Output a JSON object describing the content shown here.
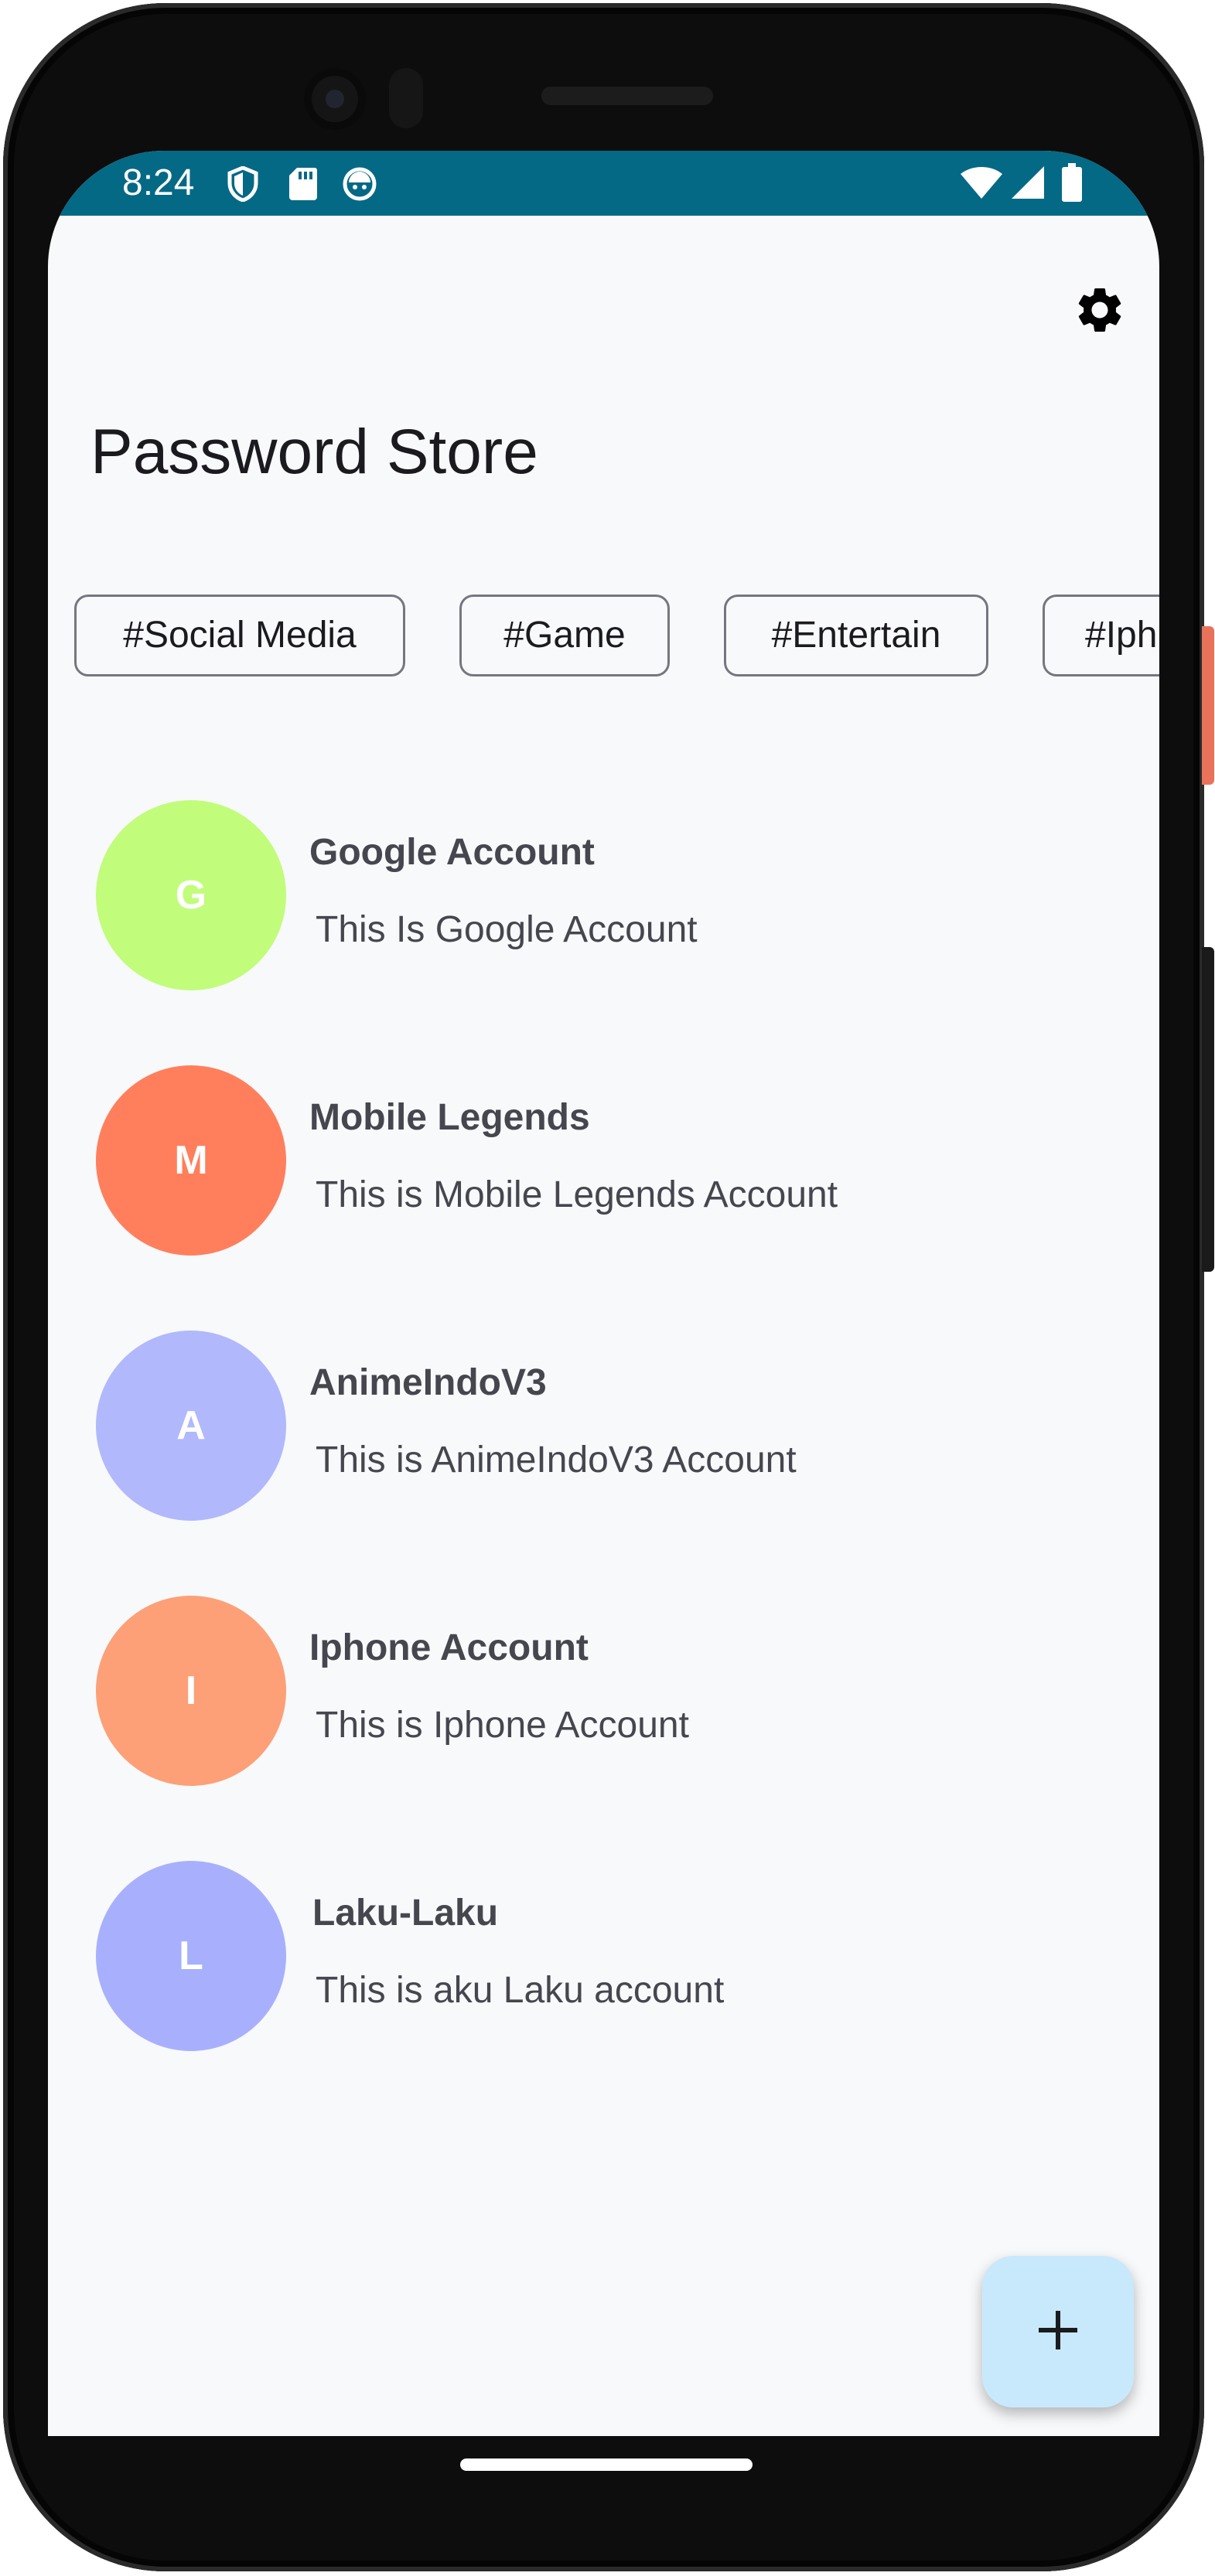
{
  "status_bar": {
    "time": "8:24",
    "icons_left": [
      "shield-icon",
      "sd-card-icon",
      "android-face-icon"
    ],
    "icons_right": [
      "wifi-icon",
      "cell-signal-icon",
      "battery-icon"
    ],
    "color": "#046985"
  },
  "header": {
    "settings_icon": "gear-icon",
    "title": "Password Store"
  },
  "tags": [
    "#Social Media",
    "#Game",
    "#Entertain",
    "#Iph"
  ],
  "accounts": [
    {
      "initial": "G",
      "title": "Google Account",
      "description": "This Is Google Account",
      "color": "#c2fc7b"
    },
    {
      "initial": "M",
      "title": "Mobile Legends",
      "description": "This is Mobile Legends Account",
      "color": "#ff7f5d"
    },
    {
      "initial": "A",
      "title": "AnimeIndoV3",
      "description": "This is AnimeIndoV3 Account",
      "color": "#b1b8fc"
    },
    {
      "initial": "I",
      "title": "Iphone Account",
      "description": "This is Iphone Account",
      "color": "#fda077"
    },
    {
      "initial": "L",
      "title": "Laku-Laku",
      "description": "This is aku Laku account",
      "color": "#a8b0fd"
    }
  ],
  "fab": {
    "icon": "plus-icon",
    "color": "#c8e9fb"
  }
}
